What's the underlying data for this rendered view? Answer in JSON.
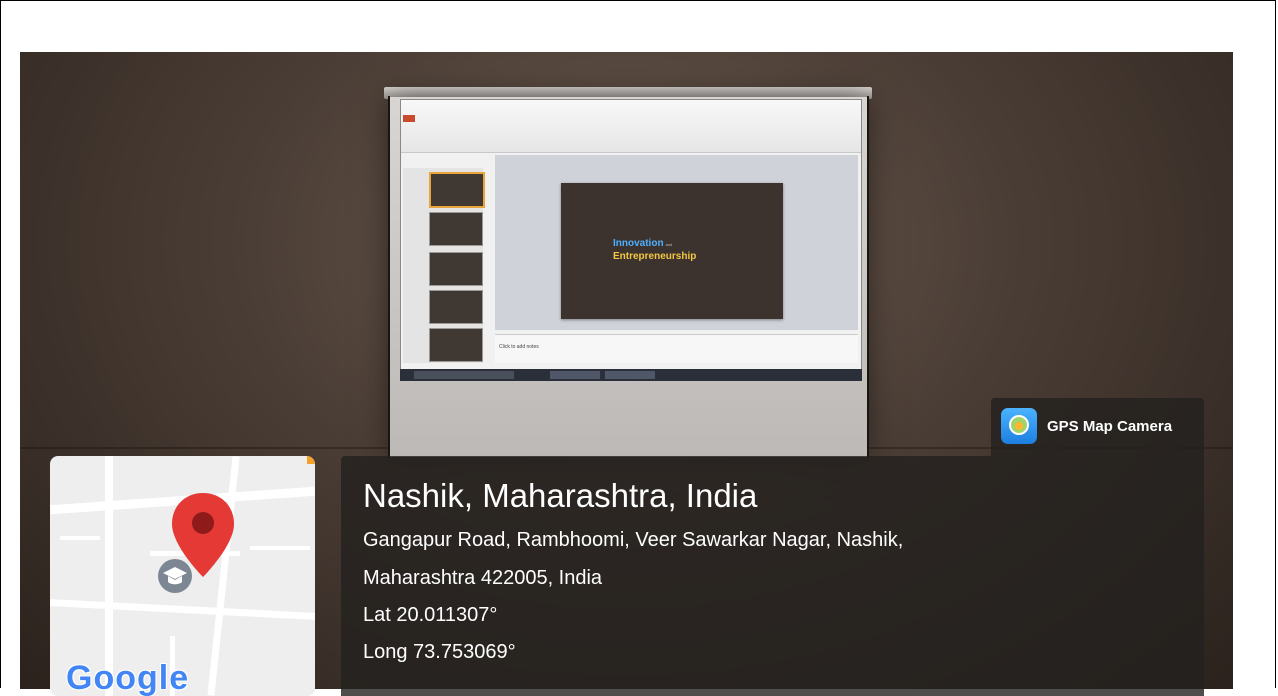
{
  "slide": {
    "line1": "Innovation",
    "and": "and",
    "line2": "Entrepreneurship",
    "notes": "Click to add notes"
  },
  "map": {
    "logo": "Google",
    "pin_icon": "location-pin-icon",
    "school_icon": "graduation-cap-icon"
  },
  "badge": {
    "app_name": "GPS Map Camera",
    "icon": "gps-camera-icon"
  },
  "location": {
    "title": "Nashik, Maharashtra, India",
    "address_line1": "Gangapur Road, Rambhoomi, Veer Sawarkar Nagar, Nashik,",
    "address_line2": "Maharashtra 422005, India",
    "lat": "Lat 20.011307°",
    "long": "Long 73.753069°"
  },
  "colors": {
    "overlay": "#23201e",
    "pin": "#e53935",
    "google_blue": "#4285f4",
    "accent": "#f4a12a"
  }
}
